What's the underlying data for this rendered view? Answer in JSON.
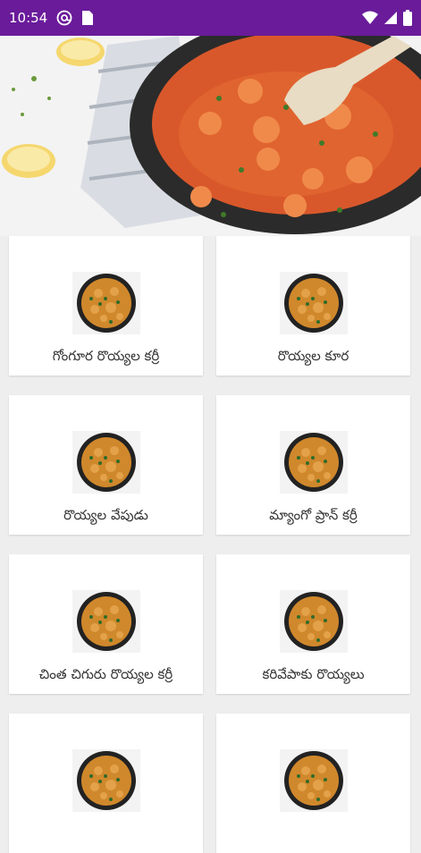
{
  "status_bar": {
    "time": "10:54",
    "icons": [
      "at-sign-icon",
      "sim-card-icon",
      "wifi-icon",
      "signal-icon",
      "battery-icon"
    ]
  },
  "hero": {
    "image": "prawn-curry-pan-image"
  },
  "recipes": [
    {
      "label": "గోంగూర రొయ్యల కర్రీ"
    },
    {
      "label": "రొయ్యల కూర"
    },
    {
      "label": "రొయ్యల వేపుడు"
    },
    {
      "label": "మ్యాంగో ప్రాన్ కర్రీ"
    },
    {
      "label": "చింత చిగురు రొయ్యల కర్రీ"
    },
    {
      "label": "కరివేపాకు రొయ్యలు"
    },
    {
      "label": ""
    },
    {
      "label": ""
    }
  ],
  "colors": {
    "status_bar": "#6a1b9a",
    "background": "#eeeeee",
    "card": "#ffffff",
    "curry": "#d9582b",
    "pan": "#2b2b2b"
  }
}
